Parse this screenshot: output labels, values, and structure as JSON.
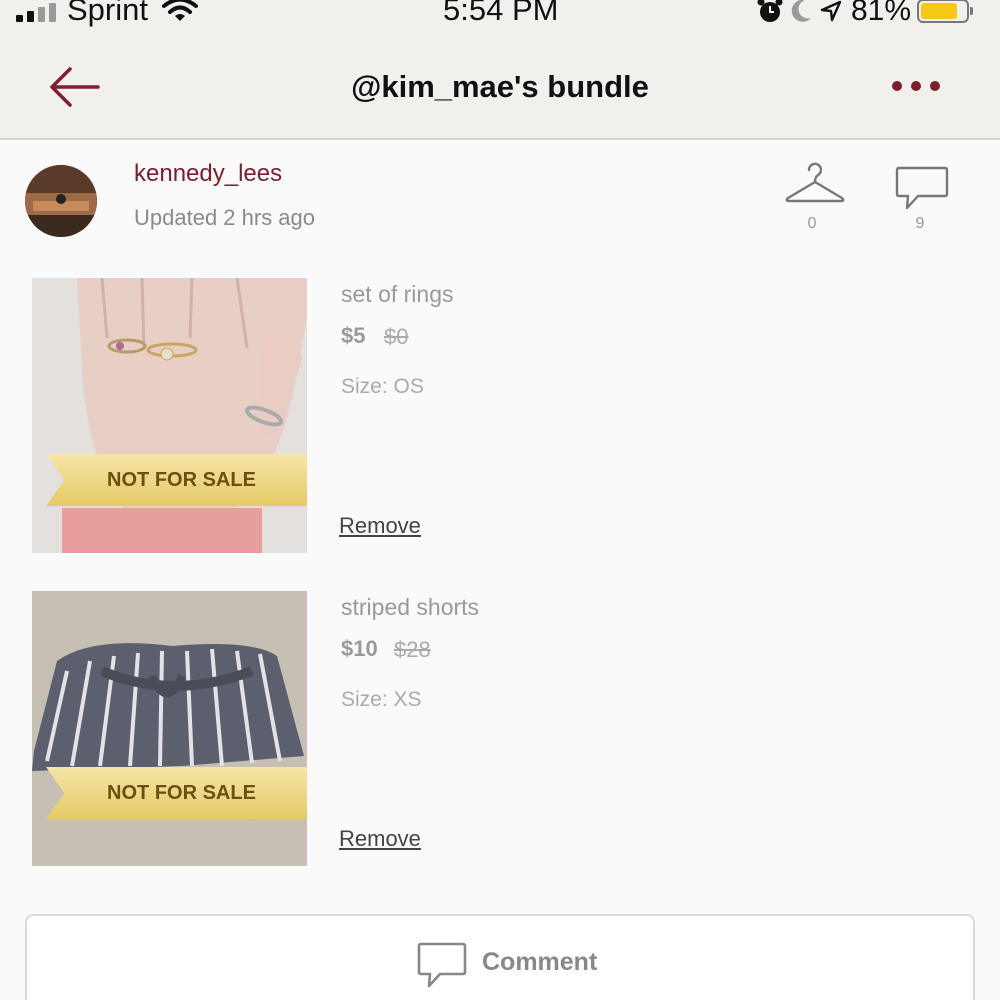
{
  "status_bar": {
    "carrier": "Sprint",
    "time": "5:54 PM",
    "battery_pct": "81%",
    "battery_level": 0.81,
    "icons": [
      "signal-icon",
      "wifi-icon",
      "alarm-icon",
      "moon-icon",
      "location-icon",
      "battery-icon"
    ]
  },
  "navbar": {
    "title": "@kim_mae's bundle",
    "back_icon": "arrow-left-icon",
    "more_icon": "ellipsis-icon",
    "accent_color": "#7b1e2e"
  },
  "seller": {
    "username": "kennedy_lees",
    "updated": "Updated 2 hrs ago",
    "likes_count": "0",
    "comments_count": "9"
  },
  "items": [
    {
      "name": "set of rings",
      "price": "$5",
      "original_price": "$0",
      "size": "Size: OS",
      "ribbon": "NOT FOR SALE",
      "remove_label": "Remove"
    },
    {
      "name": "striped shorts",
      "price": "$10",
      "original_price": "$28",
      "size": "Size: XS",
      "ribbon": "NOT FOR SALE",
      "remove_label": "Remove"
    }
  ],
  "comment_button": {
    "label": "Comment"
  }
}
